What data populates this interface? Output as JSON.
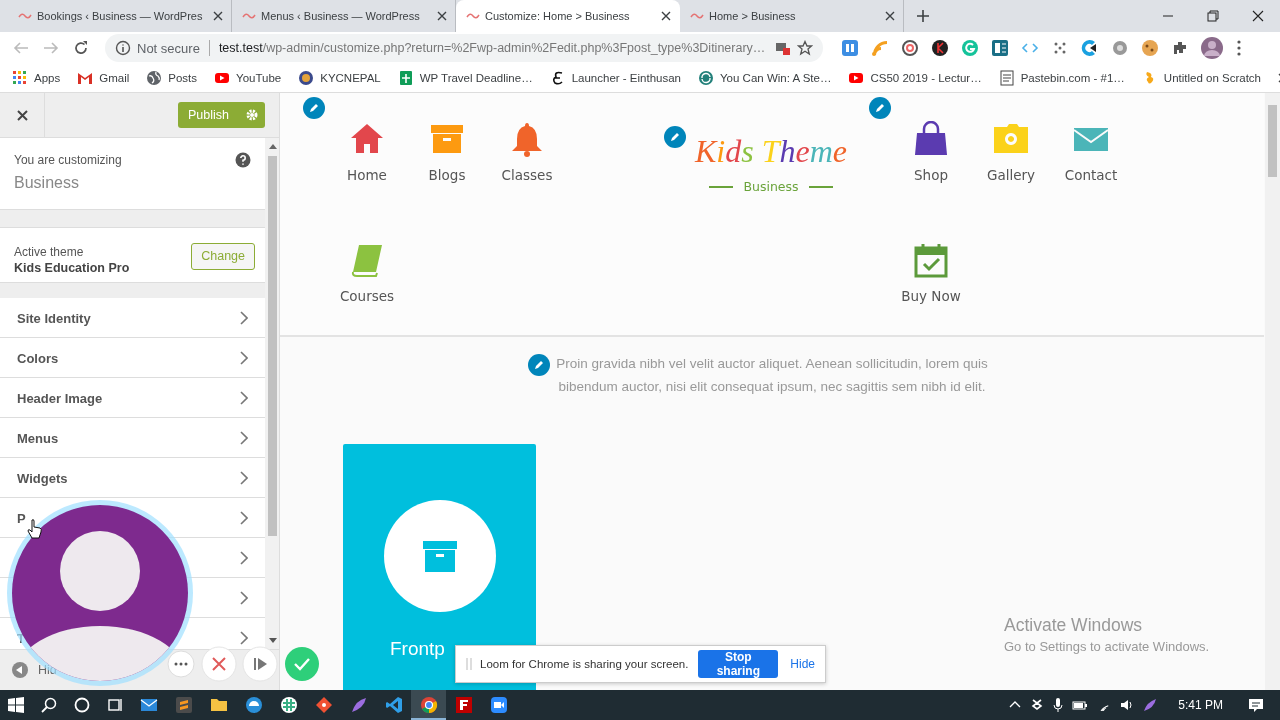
{
  "browser": {
    "tabs": [
      {
        "title": "Bookings ‹ Business — WordPres",
        "selected": false
      },
      {
        "title": "Menus ‹ Business — WordPress",
        "selected": false
      },
      {
        "title": "Customize: Home > Business",
        "selected": true
      },
      {
        "title": "Home > Business",
        "selected": false
      }
    ],
    "address": {
      "security": "Not secure",
      "host": "test.test",
      "path": "/wp-admin/customize.php?return=%2Fwp-admin%2Fedit.php%3Fpost_type%3Ditinerary…"
    },
    "bookmarks": [
      {
        "kind": "grid",
        "label": "Apps"
      },
      {
        "kind": "gmail",
        "label": "Gmail"
      },
      {
        "kind": "globe",
        "label": "Posts"
      },
      {
        "kind": "youtube",
        "label": "YouTube"
      },
      {
        "kind": "emblem",
        "label": "KYCNEPAL"
      },
      {
        "kind": "sheet",
        "label": "WP Travel Deadline…"
      },
      {
        "kind": "script",
        "label": "Launcher - Einthusan"
      },
      {
        "kind": "cycle",
        "label": "You Can Win: A Ste…"
      },
      {
        "kind": "youtube",
        "label": "CS50 2019 - Lectur…"
      },
      {
        "kind": "paste",
        "label": "Pastebin.com - #1…"
      },
      {
        "kind": "scratch",
        "label": "Untitled on Scratch"
      }
    ]
  },
  "customizer": {
    "publish": "Publish",
    "customizing_label": "You are customizing",
    "site_name": "Business",
    "theme_label": "Active theme",
    "theme_name": "Kids Education Pro",
    "change": "Change",
    "sections": [
      {
        "label": "Site Identity",
        "chevron": true
      },
      {
        "label": "Colors",
        "chevron": true
      },
      {
        "label": "Header Image",
        "chevron": true
      },
      {
        "label": "Menus",
        "chevron": true
      },
      {
        "label": "Widgets",
        "chevron": true
      },
      {
        "label": "P",
        "chevron": true
      },
      {
        "chevron": true
      },
      {
        "chevron": true
      },
      {
        "label": "T",
        "chevron": true
      }
    ],
    "hide": "Hid"
  },
  "preview": {
    "logo": "Kids Theme",
    "tagline": "Business",
    "left_menu": [
      {
        "kind": "home",
        "label": "Home",
        "color": "#e2474c"
      },
      {
        "kind": "box",
        "label": "Blogs",
        "color": "#fd9a10"
      },
      {
        "kind": "bell",
        "label": "Classes",
        "color": "#f0642a"
      },
      {
        "kind": "book",
        "label": "Courses",
        "color": "#8cc240"
      }
    ],
    "right_menu": [
      {
        "kind": "bag",
        "label": "Shop",
        "color": "#5b3bb0"
      },
      {
        "kind": "camera",
        "label": "Gallery",
        "color": "#fbd21a"
      },
      {
        "kind": "mail",
        "label": "Contact",
        "color": "#4bb5b8"
      },
      {
        "kind": "calendar",
        "label": "Buy Now",
        "color": "#5c9a3b"
      }
    ],
    "intro": "Proin gravida nibh vel velit auctor aliquet. Aenean sollicitudin, lorem quis bibendum auctor, nisi elit consequat ipsum, nec sagittis sem nibh id elit.",
    "card_title": "Frontp"
  },
  "loom": {
    "message": "Loom for Chrome is sharing your screen.",
    "stop": "Stop sharing",
    "hide": "Hide"
  },
  "windows": {
    "activate_title": "Activate Windows",
    "activate_hint": "Go to Settings to activate Windows.",
    "taskbar_apps": [
      {
        "kind": "mail",
        "selected": false
      },
      {
        "kind": "sublime",
        "selected": false
      },
      {
        "kind": "folder",
        "selected": false
      },
      {
        "kind": "edge",
        "selected": false
      },
      {
        "kind": "slack",
        "selected": false
      },
      {
        "kind": "git",
        "selected": false
      },
      {
        "kind": "feather",
        "selected": false
      },
      {
        "kind": "vscode",
        "selected": false
      },
      {
        "kind": "chrome",
        "selected": true
      },
      {
        "kind": "filezilla",
        "selected": false
      },
      {
        "kind": "zoom",
        "selected": false
      }
    ],
    "time": "5:41 PM"
  }
}
